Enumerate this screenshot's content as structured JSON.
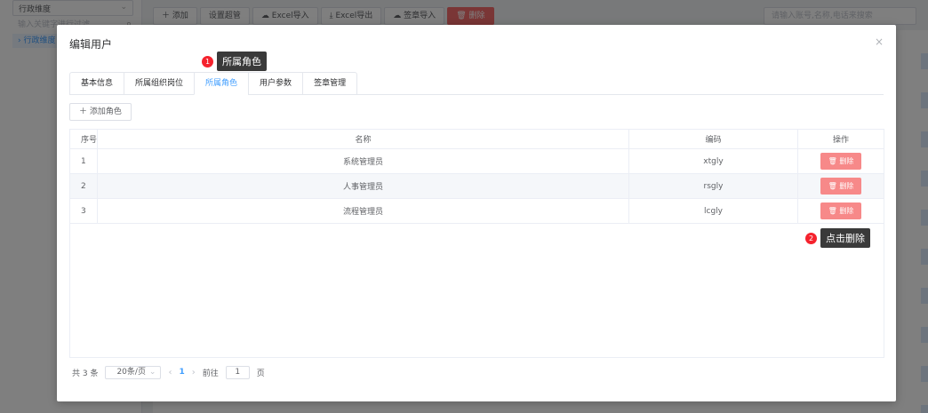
{
  "background": {
    "dimension_select": "行政维度",
    "tree_search_placeholder": "输入关键字进行过滤",
    "tree_node": "行政维度",
    "toolbar": [
      "＋ 添加",
      "设置超管",
      "Excel导入",
      "Excel导出",
      "签章导入",
      "删除"
    ],
    "user_search_placeholder": "请输入账号,名称,电话来搜索"
  },
  "dialog": {
    "title": "编辑用户",
    "close_label": "×",
    "tabs": [
      {
        "label": "基本信息"
      },
      {
        "label": "所属组织岗位"
      },
      {
        "label": "所属角色"
      },
      {
        "label": "用户参数"
      },
      {
        "label": "签章管理"
      }
    ],
    "add_role_label": "＋ 添加角色",
    "columns": [
      "序号",
      "名称",
      "编码",
      "操作"
    ],
    "rows": [
      {
        "index": "1",
        "name": "系统管理员",
        "code": "xtgly",
        "action": "删除"
      },
      {
        "index": "2",
        "name": "人事管理员",
        "code": "rsgly",
        "action": "删除"
      },
      {
        "index": "3",
        "name": "流程管理员",
        "code": "lcgly",
        "action": "删除"
      }
    ],
    "pagination": {
      "total": "共 3 条",
      "page_size": "20条/页",
      "current_page": "1",
      "goto_label": "前往",
      "goto_value": "1",
      "page_suffix": "页"
    }
  },
  "callouts": [
    {
      "number": "1",
      "text": "所属角色"
    },
    {
      "number": "2",
      "text": "点击删除"
    }
  ],
  "colors": {
    "accent": "#409eff",
    "danger": "#f56c6c",
    "callout": "#f5222d"
  }
}
